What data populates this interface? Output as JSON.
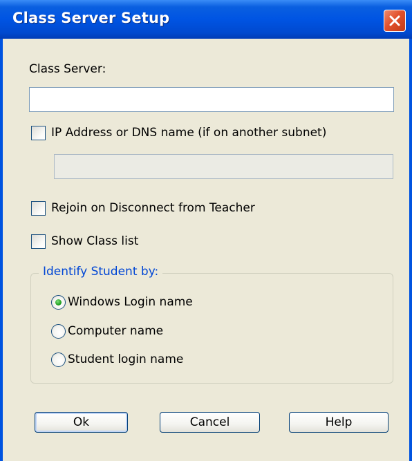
{
  "window": {
    "title": "Class Server Setup",
    "close_icon": "close-icon"
  },
  "class_server": {
    "label": "Class Server:",
    "value": ""
  },
  "ip_option": {
    "label": "IP Address or DNS name (if on another subnet)",
    "checked": false,
    "value": ""
  },
  "rejoin": {
    "label": "Rejoin on Disconnect from Teacher",
    "checked": false
  },
  "show_class_list": {
    "label": "Show Class list",
    "checked": false
  },
  "identify_group": {
    "legend": "Identify Student by:",
    "options": [
      {
        "label": "Windows Login name",
        "selected": true
      },
      {
        "label": "Computer name",
        "selected": false
      },
      {
        "label": "Student login name",
        "selected": false
      }
    ]
  },
  "buttons": {
    "ok": "Ok",
    "cancel": "Cancel",
    "help": "Help"
  },
  "colors": {
    "titlebar": "#0054e3",
    "dialog_bg": "#ece9d8",
    "group_legend": "#0046d5",
    "close": "#e2512c"
  }
}
